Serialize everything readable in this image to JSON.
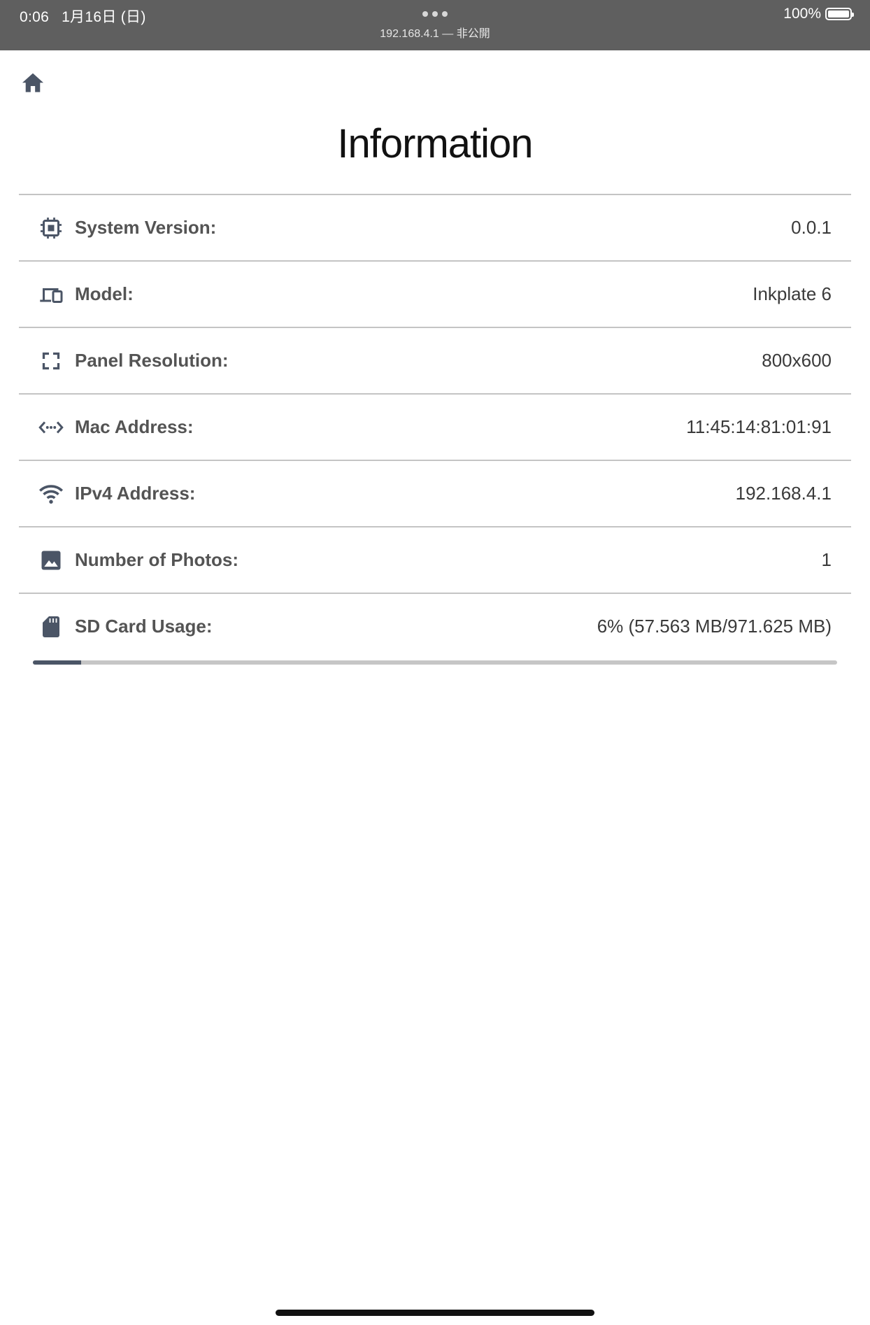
{
  "status_bar": {
    "time": "0:06",
    "date": "1月16日 (日)",
    "url": "192.168.4.1 — 非公開",
    "battery": "100%",
    "battery_fraction": 1.0
  },
  "header": {
    "home_icon": "home-icon",
    "title": "Information"
  },
  "info": {
    "rows": [
      {
        "icon": "chip-icon",
        "label": "System Version:",
        "value": "0.0.1"
      },
      {
        "icon": "devices-icon",
        "label": "Model:",
        "value": "Inkplate 6"
      },
      {
        "icon": "fullscreen-icon",
        "label": "Panel Resolution:",
        "value": "800x600"
      },
      {
        "icon": "code-arrows-icon",
        "label": "Mac Address:",
        "value": "11:45:14:81:01:91"
      },
      {
        "icon": "wifi-icon",
        "label": "IPv4 Address:",
        "value": "192.168.4.1"
      },
      {
        "icon": "image-icon",
        "label": "Number of Photos:",
        "value": "1"
      },
      {
        "icon": "sd-card-icon",
        "label": "SD Card Usage:",
        "value": "6% (57.563 MB/971.625 MB)"
      }
    ]
  },
  "sd_usage": {
    "percent": 6
  },
  "colors": {
    "status_bar_bg": "#5f5f5f",
    "icon": "#4b5566",
    "divider": "#c4c4c4",
    "progress_fill": "#4b5566",
    "progress_track": "#c6c6c6"
  }
}
